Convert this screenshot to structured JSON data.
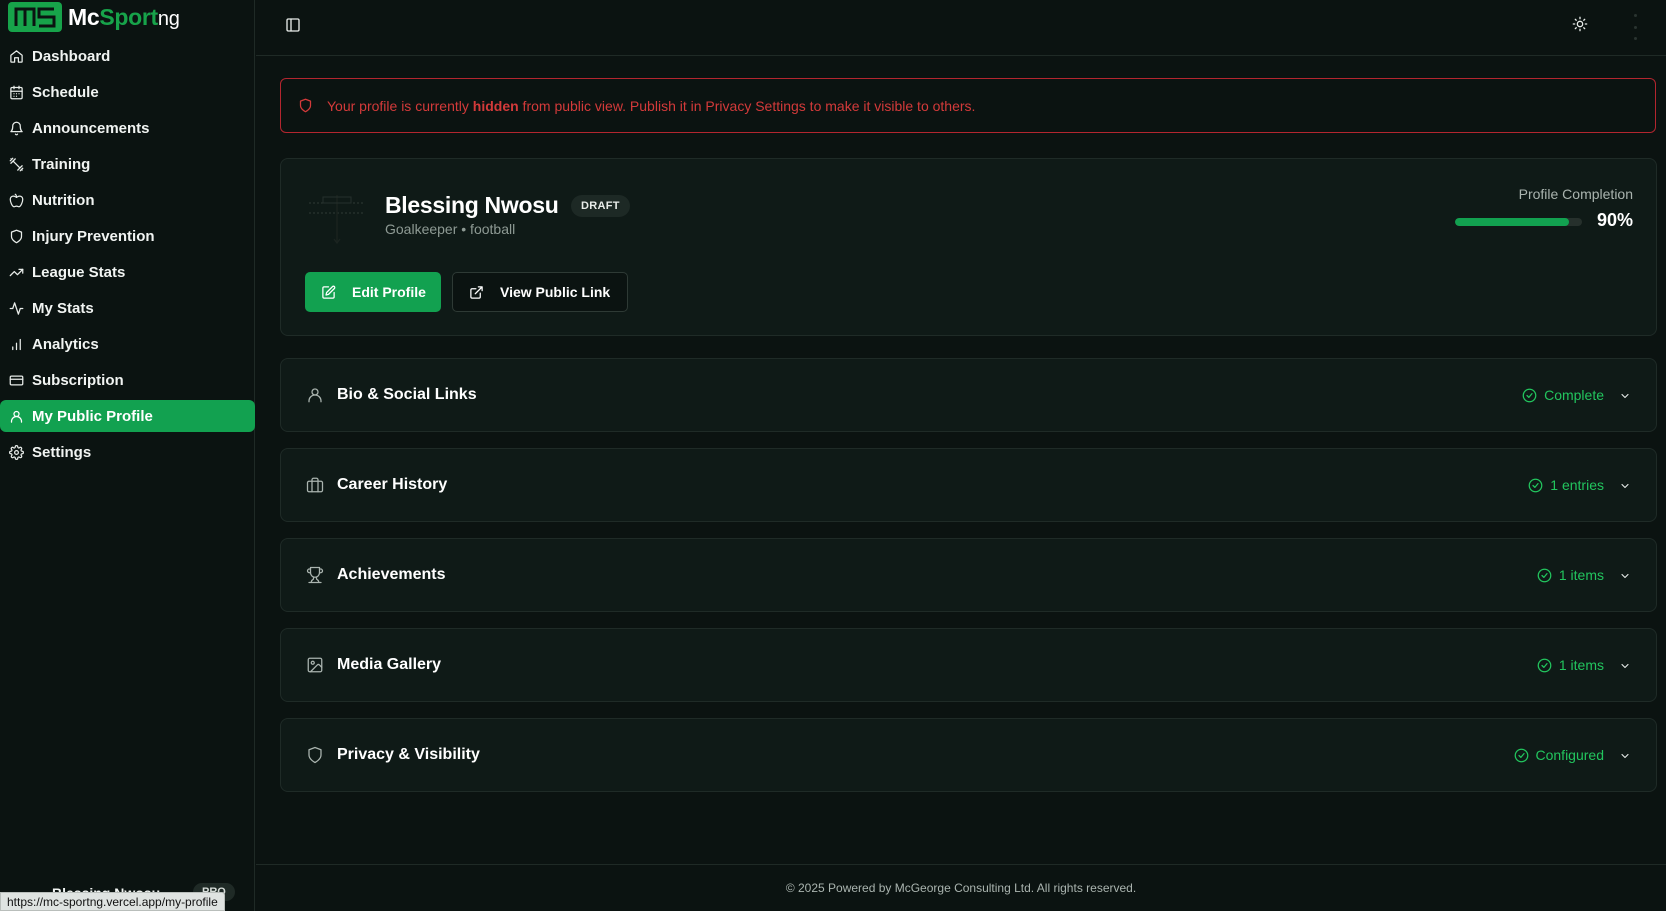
{
  "brand": {
    "mark": "MS",
    "name_mc": "Mc",
    "name_sport": "Sport",
    "name_ng": "ng",
    "accent": "#12a150"
  },
  "sidebar": {
    "items": [
      {
        "label": "Dashboard",
        "icon": "home-icon"
      },
      {
        "label": "Schedule",
        "icon": "calendar-icon"
      },
      {
        "label": "Announcements",
        "icon": "bell-icon"
      },
      {
        "label": "Training",
        "icon": "dumbbell-icon"
      },
      {
        "label": "Nutrition",
        "icon": "apple-icon"
      },
      {
        "label": "Injury Prevention",
        "icon": "shield-icon"
      },
      {
        "label": "League Stats",
        "icon": "trending-up-icon"
      },
      {
        "label": "My Stats",
        "icon": "activity-icon"
      },
      {
        "label": "Analytics",
        "icon": "bar-chart-icon"
      },
      {
        "label": "Subscription",
        "icon": "credit-card-icon"
      },
      {
        "label": "My Public Profile",
        "icon": "user-icon",
        "active": true
      },
      {
        "label": "Settings",
        "icon": "gear-icon"
      }
    ],
    "user": {
      "name": "Blessing Nwosu",
      "plan": "PRO"
    },
    "status_url": "https://mc-sportng.vercel.app/my-profile"
  },
  "alert": {
    "prefix": "Your profile is currently ",
    "emphasis": "hidden",
    "suffix": " from public view. Publish it in Privacy Settings to make it visible to others.",
    "color": "#d33a3a"
  },
  "profile": {
    "name": "Blessing Nwosu",
    "status": "DRAFT",
    "subtitle": "Goalkeeper • football",
    "completion_label": "Profile Completion",
    "completion_value": "90%",
    "completion_fraction": 0.9,
    "edit_label": "Edit Profile",
    "view_label": "View Public Link"
  },
  "sections": [
    {
      "title": "Bio & Social Links",
      "status": "Complete",
      "icon": "user-icon"
    },
    {
      "title": "Career History",
      "status": "1 entries",
      "icon": "briefcase-icon"
    },
    {
      "title": "Achievements",
      "status": "1 items",
      "icon": "trophy-icon"
    },
    {
      "title": "Media Gallery",
      "status": "1 items",
      "icon": "image-icon"
    },
    {
      "title": "Privacy & Visibility",
      "status": "Configured",
      "icon": "shield-icon"
    }
  ],
  "footer": {
    "text": "© 2025 Powered by McGeorge Consulting Ltd. All rights reserved."
  }
}
